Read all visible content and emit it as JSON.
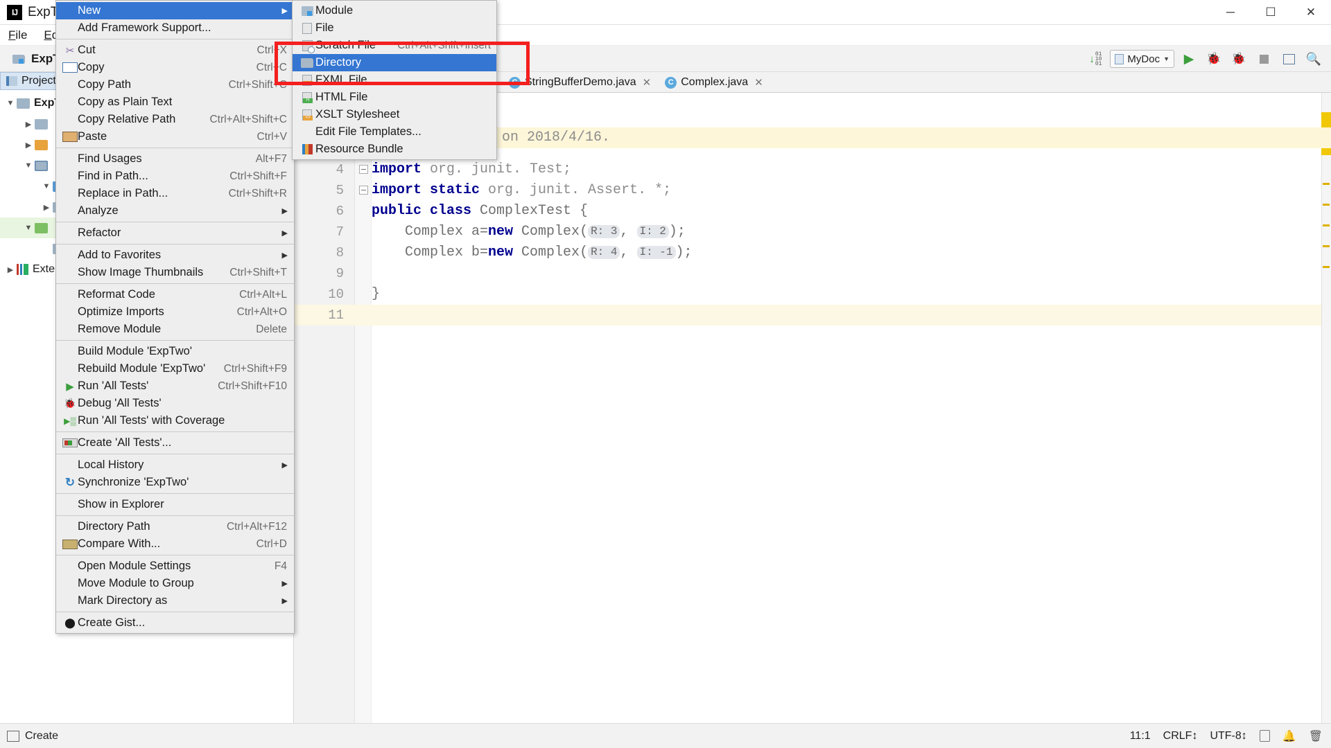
{
  "window": {
    "title": "ExpTwo",
    "logo_text": "IJ",
    "controls": {
      "minimize": "─",
      "maximize": "☐",
      "close": "✕"
    }
  },
  "menubar": {
    "items": [
      "File",
      "Edit"
    ]
  },
  "toolbar": {
    "project_name": "ExpTwo",
    "run_config": "MyDoc",
    "icons": [
      "binary-toggle-icon",
      "doc-icon",
      "run-icon",
      "debug-icon",
      "coverage-icon",
      "stop-icon",
      "layout-icon",
      "search-icon"
    ]
  },
  "project_panel": {
    "tab_label": "Project",
    "tree": [
      {
        "label": "ExpTwo",
        "indent": 0,
        "twisty": "▼",
        "folder": "f-plain",
        "bold": true
      },
      {
        "label": "",
        "indent": 1,
        "twisty": "▶",
        "folder": "f-plain",
        "bold": false
      },
      {
        "label": "",
        "indent": 1,
        "twisty": "▶",
        "folder": "f-orange",
        "bold": false
      },
      {
        "label": "",
        "indent": 1,
        "twisty": "▼",
        "folder": "f-src",
        "bold": false
      },
      {
        "label": "",
        "indent": 2,
        "twisty": "▼",
        "folder": "f-blue",
        "bold": false
      },
      {
        "label": "",
        "indent": 2,
        "twisty": "▶",
        "folder": "f-plain",
        "bold": false
      },
      {
        "label": "",
        "indent": 1,
        "twisty": "▼",
        "folder": "f-green",
        "bold": false
      },
      {
        "label": "",
        "indent": 2,
        "twisty": "",
        "folder": "f-plain",
        "bold": false
      },
      {
        "label": "Exte",
        "indent": 0,
        "twisty": "▶",
        "folder": "lib",
        "bold": false
      }
    ]
  },
  "editor_tabs": [
    {
      "label": "StringBufferDemo.java",
      "icon": "java-class-icon",
      "active": false,
      "close": "✕"
    },
    {
      "label": "Complex.java",
      "icon": "java-class-icon",
      "active": false,
      "close": "✕"
    }
  ],
  "editor": {
    "comment_banner": "on  2018/4/16.",
    "lines": [
      {
        "num": "4",
        "segments": [
          {
            "t": "import ",
            "c": "k-blue"
          },
          {
            "t": "org. junit. Test;",
            "c": "k-gray"
          }
        ],
        "fold": true,
        "hl": false
      },
      {
        "num": "5",
        "segments": [
          {
            "t": "import static ",
            "c": "k-blue"
          },
          {
            "t": "org. junit. Assert. *;",
            "c": "k-gray"
          }
        ],
        "fold": true,
        "hl": false
      },
      {
        "num": "6",
        "segments": [
          {
            "t": "public class ",
            "c": "k-blue"
          },
          {
            "t": "ComplexTest {",
            "c": "k-cls"
          }
        ],
        "fold": false,
        "hl": false
      },
      {
        "num": "7",
        "segments": [
          {
            "t": "    Complex a=",
            "c": "k-cls"
          },
          {
            "t": "new",
            "c": "k-blue"
          },
          {
            "t": " Complex(",
            "c": "k-cls"
          },
          {
            "t": "R: 3",
            "c": "hint"
          },
          {
            "t": ", ",
            "c": "k-cls"
          },
          {
            "t": "I: 2",
            "c": "hint"
          },
          {
            "t": ");",
            "c": "k-cls"
          }
        ],
        "fold": false,
        "hl": false
      },
      {
        "num": "8",
        "segments": [
          {
            "t": "    Complex b=",
            "c": "k-cls"
          },
          {
            "t": "new",
            "c": "k-blue"
          },
          {
            "t": " Complex(",
            "c": "k-cls"
          },
          {
            "t": "R: 4",
            "c": "hint"
          },
          {
            "t": ", ",
            "c": "k-cls"
          },
          {
            "t": "I: -1",
            "c": "hint"
          },
          {
            "t": ");",
            "c": "k-cls"
          }
        ],
        "fold": false,
        "hl": false
      },
      {
        "num": "9",
        "segments": [],
        "fold": false,
        "hl": false
      },
      {
        "num": "10",
        "segments": [
          {
            "t": "}",
            "c": "k-cls"
          }
        ],
        "fold": false,
        "hl": false
      },
      {
        "num": "11",
        "segments": [],
        "fold": false,
        "hl": true
      }
    ]
  },
  "context_menu": {
    "items": [
      {
        "type": "item",
        "label": "New",
        "shortcut": "",
        "icon": "",
        "arrow": "▶",
        "selected": true
      },
      {
        "type": "item",
        "label": "Add Framework Support...",
        "shortcut": "",
        "icon": "",
        "arrow": "",
        "selected": false
      },
      {
        "type": "sep"
      },
      {
        "type": "item",
        "label": "Cut",
        "shortcut": "Ctrl+X",
        "icon": "ic-cut",
        "arrow": "",
        "selected": false
      },
      {
        "type": "item",
        "label": "Copy",
        "shortcut": "Ctrl+C",
        "icon": "ic-copy",
        "arrow": "",
        "selected": false
      },
      {
        "type": "item",
        "label": "Copy Path",
        "shortcut": "Ctrl+Shift+C",
        "icon": "",
        "arrow": "",
        "selected": false
      },
      {
        "type": "item",
        "label": "Copy as Plain Text",
        "shortcut": "",
        "icon": "",
        "arrow": "",
        "selected": false
      },
      {
        "type": "item",
        "label": "Copy Relative Path",
        "shortcut": "Ctrl+Alt+Shift+C",
        "icon": "",
        "arrow": "",
        "selected": false
      },
      {
        "type": "item",
        "label": "Paste",
        "shortcut": "Ctrl+V",
        "icon": "ic-paste",
        "arrow": "",
        "selected": false
      },
      {
        "type": "sep"
      },
      {
        "type": "item",
        "label": "Find Usages",
        "shortcut": "Alt+F7",
        "icon": "",
        "arrow": "",
        "selected": false
      },
      {
        "type": "item",
        "label": "Find in Path...",
        "shortcut": "Ctrl+Shift+F",
        "icon": "",
        "arrow": "",
        "selected": false
      },
      {
        "type": "item",
        "label": "Replace in Path...",
        "shortcut": "Ctrl+Shift+R",
        "icon": "",
        "arrow": "",
        "selected": false
      },
      {
        "type": "item",
        "label": "Analyze",
        "shortcut": "",
        "icon": "",
        "arrow": "▶",
        "selected": false
      },
      {
        "type": "sep"
      },
      {
        "type": "item",
        "label": "Refactor",
        "shortcut": "",
        "icon": "",
        "arrow": "▶",
        "selected": false
      },
      {
        "type": "sep"
      },
      {
        "type": "item",
        "label": "Add to Favorites",
        "shortcut": "",
        "icon": "",
        "arrow": "▶",
        "selected": false
      },
      {
        "type": "item",
        "label": "Show Image Thumbnails",
        "shortcut": "Ctrl+Shift+T",
        "icon": "",
        "arrow": "",
        "selected": false
      },
      {
        "type": "sep"
      },
      {
        "type": "item",
        "label": "Reformat Code",
        "shortcut": "Ctrl+Alt+L",
        "icon": "",
        "arrow": "",
        "selected": false
      },
      {
        "type": "item",
        "label": "Optimize Imports",
        "shortcut": "Ctrl+Alt+O",
        "icon": "",
        "arrow": "",
        "selected": false
      },
      {
        "type": "item",
        "label": "Remove Module",
        "shortcut": "Delete",
        "icon": "",
        "arrow": "",
        "selected": false
      },
      {
        "type": "sep"
      },
      {
        "type": "item",
        "label": "Build Module 'ExpTwo'",
        "shortcut": "",
        "icon": "",
        "arrow": "",
        "selected": false
      },
      {
        "type": "item",
        "label": "Rebuild Module 'ExpTwo'",
        "shortcut": "Ctrl+Shift+F9",
        "icon": "",
        "arrow": "",
        "selected": false
      },
      {
        "type": "item",
        "label": "Run 'All Tests'",
        "shortcut": "Ctrl+Shift+F10",
        "icon": "ic-play",
        "arrow": "",
        "selected": false
      },
      {
        "type": "item",
        "label": "Debug 'All Tests'",
        "shortcut": "",
        "icon": "ic-bug",
        "arrow": "",
        "selected": false
      },
      {
        "type": "item",
        "label": "Run 'All Tests' with Coverage",
        "shortcut": "",
        "icon": "ic-cov",
        "arrow": "",
        "selected": false
      },
      {
        "type": "sep"
      },
      {
        "type": "item",
        "label": "Create 'All Tests'...",
        "shortcut": "",
        "icon": "ic-win",
        "arrow": "",
        "selected": false
      },
      {
        "type": "sep"
      },
      {
        "type": "item",
        "label": "Local History",
        "shortcut": "",
        "icon": "",
        "arrow": "▶",
        "selected": false
      },
      {
        "type": "item",
        "label": "Synchronize 'ExpTwo'",
        "shortcut": "",
        "icon": "ic-sync",
        "arrow": "",
        "selected": false
      },
      {
        "type": "sep"
      },
      {
        "type": "item",
        "label": "Show in Explorer",
        "shortcut": "",
        "icon": "",
        "arrow": "",
        "selected": false
      },
      {
        "type": "sep"
      },
      {
        "type": "item",
        "label": "Directory Path",
        "shortcut": "Ctrl+Alt+F12",
        "icon": "",
        "arrow": "",
        "selected": false
      },
      {
        "type": "item",
        "label": "Compare With...",
        "shortcut": "Ctrl+D",
        "icon": "ic-cmp",
        "arrow": "",
        "selected": false
      },
      {
        "type": "sep"
      },
      {
        "type": "item",
        "label": "Open Module Settings",
        "shortcut": "F4",
        "icon": "",
        "arrow": "",
        "selected": false
      },
      {
        "type": "item",
        "label": "Move Module to Group",
        "shortcut": "",
        "icon": "",
        "arrow": "▶",
        "selected": false
      },
      {
        "type": "item",
        "label": "Mark Directory as",
        "shortcut": "",
        "icon": "",
        "arrow": "▶",
        "selected": false
      },
      {
        "type": "sep"
      },
      {
        "type": "item",
        "label": "Create Gist...",
        "shortcut": "",
        "icon": "ic-git",
        "arrow": "",
        "selected": false
      }
    ]
  },
  "submenu": {
    "items": [
      {
        "label": "Module",
        "shortcut": "",
        "icon": "ic-module",
        "selected": false
      },
      {
        "label": "File",
        "shortcut": "",
        "icon": "ic-file",
        "selected": false
      },
      {
        "label": "Scratch File",
        "shortcut": "Ctrl+Alt+Shift+Insert",
        "icon": "ic-scratch",
        "selected": false
      },
      {
        "label": "Directory",
        "shortcut": "",
        "icon": "ic-dir",
        "selected": true
      },
      {
        "label": "FXML File",
        "shortcut": "",
        "icon": "ic-fxml",
        "selected": false
      },
      {
        "label": "HTML File",
        "shortcut": "",
        "icon": "ic-html",
        "selected": false
      },
      {
        "label": "XSLT Stylesheet",
        "shortcut": "",
        "icon": "ic-xslt",
        "selected": false
      },
      {
        "label": "Edit File Templates...",
        "shortcut": "",
        "icon": "",
        "selected": false
      },
      {
        "label": "Resource Bundle",
        "shortcut": "",
        "icon": "ic-bundle",
        "selected": false
      }
    ]
  },
  "annotation": {
    "color": "#f41f1f",
    "shape": "rectangle",
    "highlights": "Directory"
  },
  "statusbar": {
    "left_label": "Create",
    "caret": "11:1",
    "line_separator": "CRLF↕",
    "encoding": "UTF-8↕",
    "icons": [
      "lock-icon",
      "bell-icon",
      "trash-icon"
    ]
  }
}
